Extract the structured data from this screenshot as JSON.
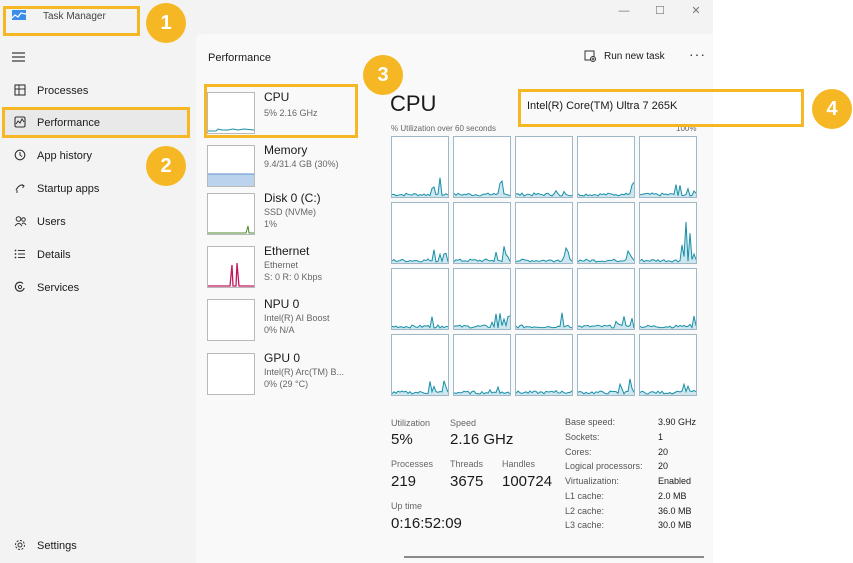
{
  "app": {
    "title": "Task Manager",
    "window_buttons": [
      "—",
      "☐",
      "✕"
    ]
  },
  "sidebar": {
    "menu_icon": "hamburger-icon",
    "items": [
      {
        "label": "Processes",
        "icon": "processes-icon"
      },
      {
        "label": "Performance",
        "icon": "performance-icon"
      },
      {
        "label": "App history",
        "icon": "history-icon"
      },
      {
        "label": "Startup apps",
        "icon": "startup-icon"
      },
      {
        "label": "Users",
        "icon": "users-icon"
      },
      {
        "label": "Details",
        "icon": "details-icon"
      },
      {
        "label": "Services",
        "icon": "services-icon"
      }
    ],
    "settings_label": "Settings"
  },
  "header": {
    "title": "Performance",
    "run_task_label": "Run new task",
    "more": "···"
  },
  "devices": [
    {
      "name": "CPU",
      "sub1": "5% 2.16 GHz",
      "sub2": ""
    },
    {
      "name": "Memory",
      "sub1": "9.4/31.4 GB (30%)",
      "sub2": ""
    },
    {
      "name": "Disk 0 (C:)",
      "sub1": "SSD (NVMe)",
      "sub2": "1%"
    },
    {
      "name": "Ethernet",
      "sub1": "Ethernet",
      "sub2": "S: 0 R: 0 Kbps"
    },
    {
      "name": "NPU 0",
      "sub1": "Intel(R) AI Boost",
      "sub2": "0% N/A"
    },
    {
      "name": "GPU 0",
      "sub1": "Intel(R) Arc(TM) B...",
      "sub2": "0% (29 °C)"
    }
  ],
  "cpu": {
    "title": "CPU",
    "model": "Intel(R) Core(TM) Ultra 7 265K",
    "util_label": "% Utilization over 60 seconds",
    "max_label": "100%",
    "core_count_shown": 20
  },
  "stats": {
    "utilization_label": "Utilization",
    "utilization": "5%",
    "speed_label": "Speed",
    "speed": "2.16 GHz",
    "processes_label": "Processes",
    "processes": "219",
    "threads_label": "Threads",
    "threads": "3675",
    "handles_label": "Handles",
    "handles": "100724",
    "uptime_label": "Up time",
    "uptime": "0:16:52:09"
  },
  "specs": [
    {
      "label": "Base speed:",
      "value": "3.90 GHz"
    },
    {
      "label": "Sockets:",
      "value": "1"
    },
    {
      "label": "Cores:",
      "value": "20"
    },
    {
      "label": "Logical processors:",
      "value": "20"
    },
    {
      "label": "Virtualization:",
      "value": "Enabled"
    },
    {
      "label": "L1 cache:",
      "value": "2.0 MB"
    },
    {
      "label": "L2 cache:",
      "value": "36.0 MB"
    },
    {
      "label": "L3 cache:",
      "value": "30.0 MB"
    }
  ],
  "annotations": [
    {
      "number": "1"
    },
    {
      "number": "2"
    },
    {
      "number": "3"
    },
    {
      "number": "4"
    }
  ],
  "colors": {
    "accent": "#f5b824",
    "cpu_graph": "#1790a8",
    "memory_graph": "#5b8fc9",
    "disk_graph": "#4c8a2e",
    "ethernet_graph": "#c2185b"
  }
}
